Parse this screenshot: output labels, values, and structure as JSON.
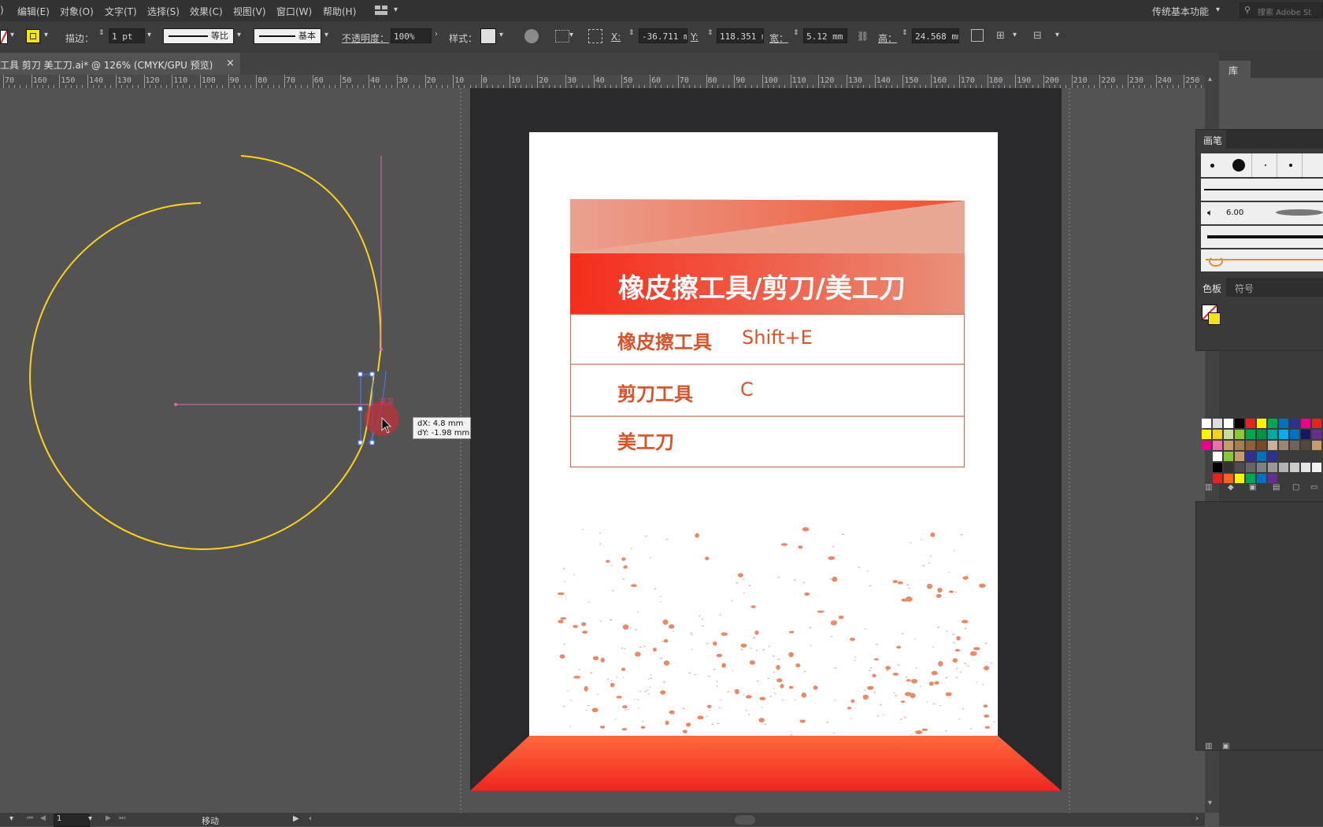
{
  "menu": {
    "items": [
      "编辑(E)",
      "对象(O)",
      "文字(T)",
      "选择(S)",
      "效果(C)",
      "视图(V)",
      "窗口(W)",
      "帮助(H)"
    ],
    "workspace": "传统基本功能",
    "search_placeholder": "搜索 Adobe St"
  },
  "control": {
    "stroke_label": "描边：",
    "stroke_value": "1 pt",
    "profile_label": "等比",
    "brush_label": "基本",
    "opacity_label": "不透明度：",
    "opacity_value": "100%",
    "style_label": "样式：",
    "x_label": "X:",
    "x_value": "-36.711 m",
    "y_label": "Y:",
    "y_value": "118.351 m",
    "w_label": "宽：",
    "w_value": "5.12 mm",
    "h_label": "高：",
    "h_value": "24.568 mm"
  },
  "document": {
    "tab_title": "工具 剪刀 美工刀.ai* @ 126% (CMYK/GPU 预览)",
    "tab_close": "×"
  },
  "ruler": {
    "labels": [
      "70",
      "160",
      "150",
      "140",
      "130",
      "120",
      "110",
      "100",
      "90",
      "80",
      "70",
      "60",
      "50",
      "40",
      "30",
      "20",
      "10",
      "0",
      "10",
      "20",
      "30",
      "40",
      "50",
      "60",
      "70",
      "80",
      "90",
      "100",
      "110",
      "120",
      "130",
      "140",
      "150",
      "160",
      "170",
      "180",
      "190",
      "200",
      "210",
      "220",
      "230",
      "240",
      "250"
    ]
  },
  "canvas": {
    "tooltip_dx": "dX: 4.8 mm",
    "tooltip_dy": "dY: -1.98 mm",
    "anchor_hint": "交叉"
  },
  "poster": {
    "title": "橡皮擦工具/剪刀/美工刀",
    "rows": [
      {
        "name": "橡皮擦工具",
        "shortcut": "Shift+E"
      },
      {
        "name": "剪刀工具",
        "shortcut": "C"
      },
      {
        "name": "美工刀",
        "shortcut": ""
      }
    ],
    "colors": {
      "accent": "#e8502a",
      "text": "#d9532a",
      "stage_dark": "#2a2a2c"
    }
  },
  "panels": {
    "library_tab": "库",
    "brushes_tab": "画笔",
    "brush_size": "6.00",
    "swatches_tab": "色板",
    "symbols_tab": "符号"
  },
  "status": {
    "page": "1",
    "mode": "移动"
  }
}
